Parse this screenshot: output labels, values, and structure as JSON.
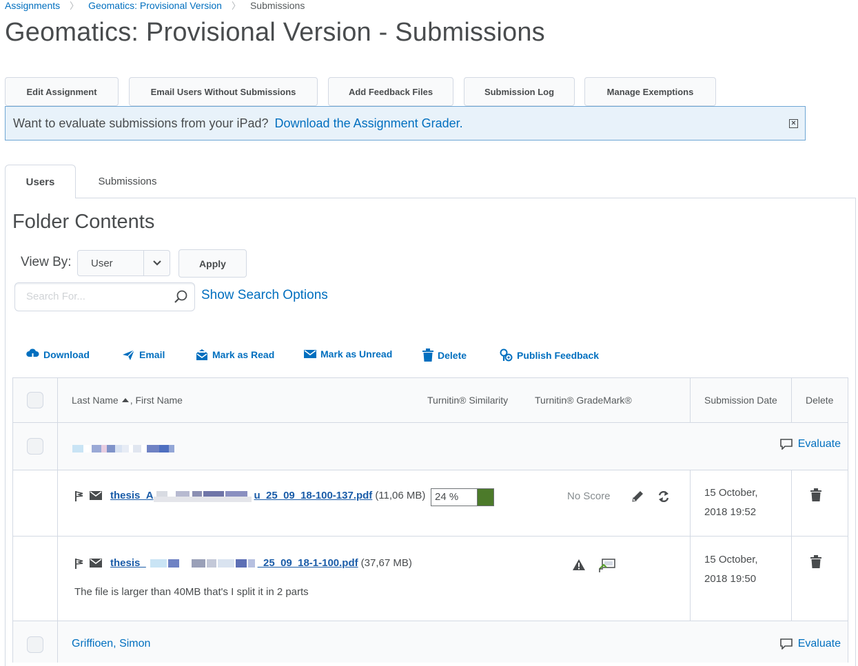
{
  "breadcrumb": {
    "items": [
      "Assignments",
      "Geomatics: Provisional Version"
    ],
    "current": "Submissions"
  },
  "page_title": "Geomatics: Provisional Version - Submissions",
  "actions": {
    "edit": "Edit Assignment",
    "email_users": "Email Users Without Submissions",
    "add_feedback": "Add Feedback Files",
    "submission_log": "Submission Log",
    "manage_exemptions": "Manage Exemptions"
  },
  "alert": {
    "message": "Want to evaluate submissions from your iPad?",
    "link": "Download the Assignment Grader."
  },
  "tabs": {
    "users": "Users",
    "submissions": "Submissions"
  },
  "folder_title": "Folder Contents",
  "view_by": {
    "label": "View By:",
    "value": "User",
    "apply": "Apply"
  },
  "search": {
    "placeholder": "Search For...",
    "show_options": "Show Search Options"
  },
  "toolbar": {
    "download": "Download",
    "email": "Email",
    "mark_read": "Mark as Read",
    "mark_unread": "Mark as Unread",
    "delete": "Delete",
    "publish": "Publish Feedback"
  },
  "table": {
    "headers": {
      "name_last": "Last Name",
      "name_first": ", First Name",
      "similarity": "Turnitin® Similarity",
      "grademark": "Turnitin® GradeMark®",
      "date": "Submission Date",
      "delete": "Delete"
    },
    "evaluate_label": "Evaluate",
    "submissions": [
      {
        "file_prefix": "thesis_A",
        "file_suffix": "u_25_09_18-100-137.pdf",
        "size": "(11,06 MB)",
        "similarity": "24 %",
        "score": "No Score",
        "date_line1": "15 October,",
        "date_line2": "2018 19:52"
      },
      {
        "file_prefix": "thesis_",
        "file_suffix": "_25_09_18-1-100.pdf",
        "size": "(37,67 MB)",
        "comment": "The file is larger than 40MB that's I split it in 2 parts",
        "date_line1": "15 October,",
        "date_line2": "2018 19:50"
      }
    ],
    "user2_name": "Griffioen, Simon"
  },
  "colors": {
    "link": "#006fbf",
    "alert_bg": "#e8f2fa",
    "similarity_bar": "#4c7a2a"
  }
}
